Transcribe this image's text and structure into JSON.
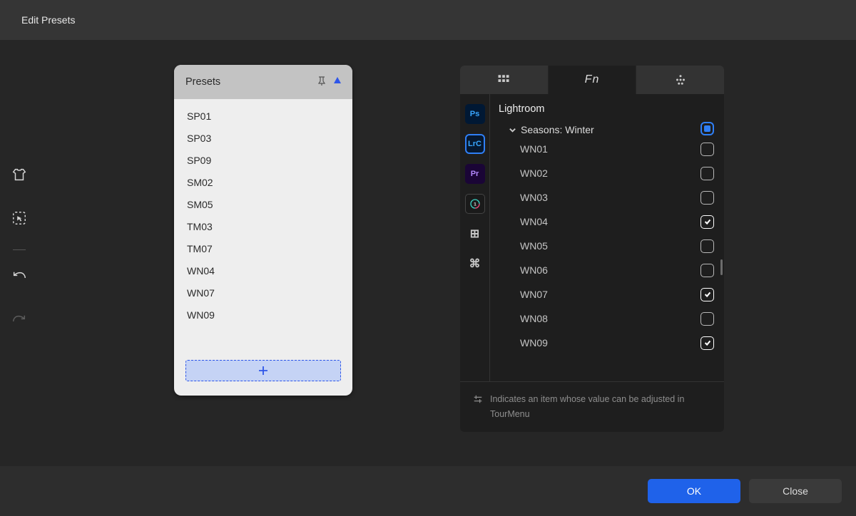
{
  "titlebar": {
    "title": "Edit Presets"
  },
  "presets_panel": {
    "title": "Presets",
    "items": [
      "SP01",
      "SP03",
      "SP09",
      "SM02",
      "SM05",
      "TM03",
      "TM07",
      "WN04",
      "WN07",
      "WN09"
    ]
  },
  "right_panel": {
    "active_tab": 1,
    "tabs": [
      "grid",
      "fn",
      "dots"
    ],
    "app_rail": [
      {
        "id": "ps",
        "label": "Ps"
      },
      {
        "id": "lrc",
        "label": "LrC"
      },
      {
        "id": "pr",
        "label": "Pr"
      },
      {
        "id": "c1",
        "label": ""
      },
      {
        "id": "win",
        "label": "⊞"
      },
      {
        "id": "cmd",
        "label": "⌘"
      }
    ],
    "content_title": "Lightroom",
    "group": {
      "label": "Seasons: Winter",
      "expanded": true,
      "state": "mixed"
    },
    "items": [
      {
        "label": "WN01",
        "checked": false
      },
      {
        "label": "WN02",
        "checked": false
      },
      {
        "label": "WN03",
        "checked": false
      },
      {
        "label": "WN04",
        "checked": true
      },
      {
        "label": "WN05",
        "checked": false
      },
      {
        "label": "WN06",
        "checked": false
      },
      {
        "label": "WN07",
        "checked": true
      },
      {
        "label": "WN08",
        "checked": false
      },
      {
        "label": "WN09",
        "checked": true
      }
    ],
    "hint": "Indicates an item whose value can be adjusted in TourMenu"
  },
  "footer": {
    "ok": "OK",
    "close": "Close"
  }
}
